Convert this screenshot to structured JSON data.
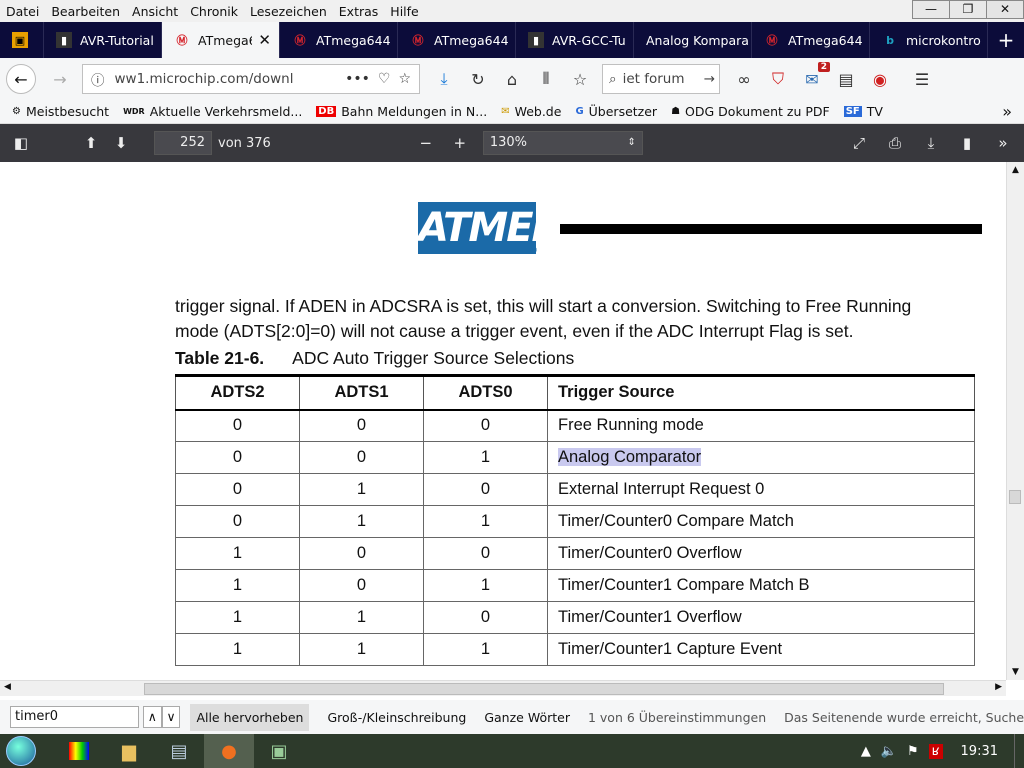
{
  "menu": [
    "Datei",
    "Bearbeiten",
    "Ansicht",
    "Chronik",
    "Lesezeichen",
    "Extras",
    "Hilfe"
  ],
  "window_controls": {
    "minimize": "—",
    "maximize": "❐",
    "close": "✕"
  },
  "tabs": [
    {
      "label": "",
      "icon": "avr-icon"
    },
    {
      "label": "AVR-Tutorial",
      "icon": "avr-icon"
    },
    {
      "label": "ATmega644",
      "icon": "microchip-icon",
      "active": true
    },
    {
      "label": "ATmega644",
      "icon": "microchip-icon"
    },
    {
      "label": "ATmega644",
      "icon": "microchip-icon"
    },
    {
      "label": "AVR-GCC-Tu",
      "icon": "avr-icon"
    },
    {
      "label": "Analog Kompara",
      "icon": "none"
    },
    {
      "label": "ATmega644",
      "icon": "microchip-icon"
    },
    {
      "label": "microkontro",
      "icon": "bing-icon"
    }
  ],
  "newtab_label": "+",
  "nav": {
    "url": "ww1.microchip.com/downl",
    "search_text": "iet forum"
  },
  "notifications_count": "2",
  "bookmarks": [
    {
      "label": "Meistbesucht",
      "icon": "⚙"
    },
    {
      "label": "Aktuelle Verkehrsmeld...",
      "icon": "WDR"
    },
    {
      "label": "Bahn Meldungen in N...",
      "icon": "DB"
    },
    {
      "label": "Web.de",
      "icon": "✉"
    },
    {
      "label": "Übersetzer",
      "icon": "G"
    },
    {
      "label": "ODG Dokument zu PDF",
      "icon": "☗"
    },
    {
      "label": "TV",
      "icon": "SF"
    }
  ],
  "pdf_toolbar": {
    "page": "252",
    "of_label": "von 376",
    "zoom": "130%"
  },
  "document": {
    "logo_text": "ATMEL",
    "logo_reg": "®",
    "para_line1": "trigger signal. If ADEN in ADCSRA is set, this will start a conversion. Switching to Free Running",
    "para_line2": "mode (ADTS[2:0]=0) will not cause a trigger event, even if the ADC Interrupt Flag is set.",
    "table_number": "Table 21-6.",
    "table_title": "ADC Auto Trigger Source Selections",
    "headers": [
      "ADTS2",
      "ADTS1",
      "ADTS0",
      "Trigger Source"
    ],
    "rows": [
      [
        "0",
        "0",
        "0",
        "Free Running mode"
      ],
      [
        "0",
        "0",
        "1",
        "Analog Comparator"
      ],
      [
        "0",
        "1",
        "0",
        "External Interrupt Request 0"
      ],
      [
        "0",
        "1",
        "1",
        "Timer/Counter0 Compare Match"
      ],
      [
        "1",
        "0",
        "0",
        "Timer/Counter0 Overflow"
      ],
      [
        "1",
        "0",
        "1",
        "Timer/Counter1 Compare Match B"
      ],
      [
        "1",
        "1",
        "0",
        "Timer/Counter1 Overflow"
      ],
      [
        "1",
        "1",
        "1",
        "Timer/Counter1 Capture Event"
      ]
    ],
    "highlight_color": "#c9c9ef"
  },
  "findbar": {
    "query": "timer0",
    "highlight_all": "Alle hervorheben",
    "match_case": "Groß-/Kleinschreibung",
    "whole_words": "Ganze Wörter",
    "status": "1 von 6 Übereinstimmungen",
    "end_notice": "Das Seitenende wurde erreicht, Suche"
  },
  "taskbar": {
    "time": "19:31"
  }
}
